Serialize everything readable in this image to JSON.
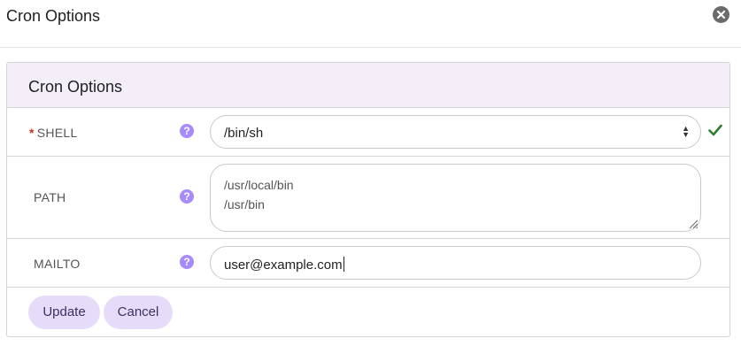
{
  "dialog": {
    "title": "Cron Options"
  },
  "panel": {
    "title": "Cron Options"
  },
  "fields": {
    "shell": {
      "required_marker": "*",
      "label": "SHELL",
      "help": "?",
      "value": "/bin/sh"
    },
    "path": {
      "label": "PATH",
      "help": "?",
      "lines": [
        "/usr/local/bin",
        "/usr/bin"
      ]
    },
    "mailto": {
      "label": "MAILTO",
      "help": "?",
      "value": "user@example.com"
    }
  },
  "buttons": {
    "update": "Update",
    "cancel": "Cancel"
  },
  "colors": {
    "panel_header_bg": "#f3eef8",
    "help_icon": "#a78bfa",
    "button_bg": "#e6dcf9",
    "valid_check": "#2e7d32",
    "required": "#c0392b"
  }
}
